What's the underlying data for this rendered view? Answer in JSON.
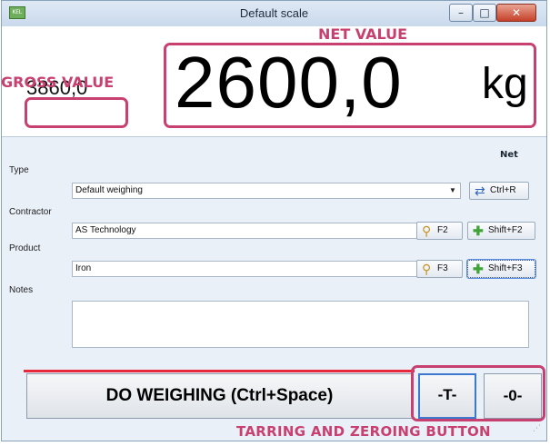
{
  "window": {
    "title": "Default scale",
    "app_icon_text": "KEL",
    "minimize_glyph": "–",
    "maximize_glyph": "□",
    "close_glyph": "✕"
  },
  "readout": {
    "gross_value": "3860,0",
    "net_value": "2600,0",
    "unit": "kg",
    "mode_label": "Net"
  },
  "form": {
    "type": {
      "label": "Type",
      "value": "Default weighing",
      "button": {
        "icon": "refresh-icon",
        "shortcut": "Ctrl+R"
      }
    },
    "contractor": {
      "label": "Contractor",
      "value": "AS Technology",
      "search_button": {
        "icon": "search-icon",
        "shortcut": "F2"
      },
      "add_button": {
        "icon": "add-icon",
        "shortcut": "Shift+F2"
      }
    },
    "product": {
      "label": "Product",
      "value": "Iron",
      "search_button": {
        "icon": "search-icon",
        "shortcut": "F3"
      },
      "add_button": {
        "icon": "add-icon",
        "shortcut": "Shift+F3"
      }
    },
    "notes": {
      "label": "Notes",
      "value": ""
    }
  },
  "actions": {
    "do_weighing": "DO WEIGHING (Ctrl+Space)",
    "tare": "-T-",
    "zero": "-0-"
  },
  "annotations": {
    "net_value": "NET VALUE",
    "gross_value": "GROSS VALUE",
    "tarring_zeroing": "TARRING AND ZEROING  BUTTON",
    "color": "#c8406f"
  },
  "colors": {
    "window_bg": "#eaf0f8",
    "close_button": "#c5412a",
    "focus_border": "#3b78d0",
    "separator_line": "#e8283c"
  }
}
